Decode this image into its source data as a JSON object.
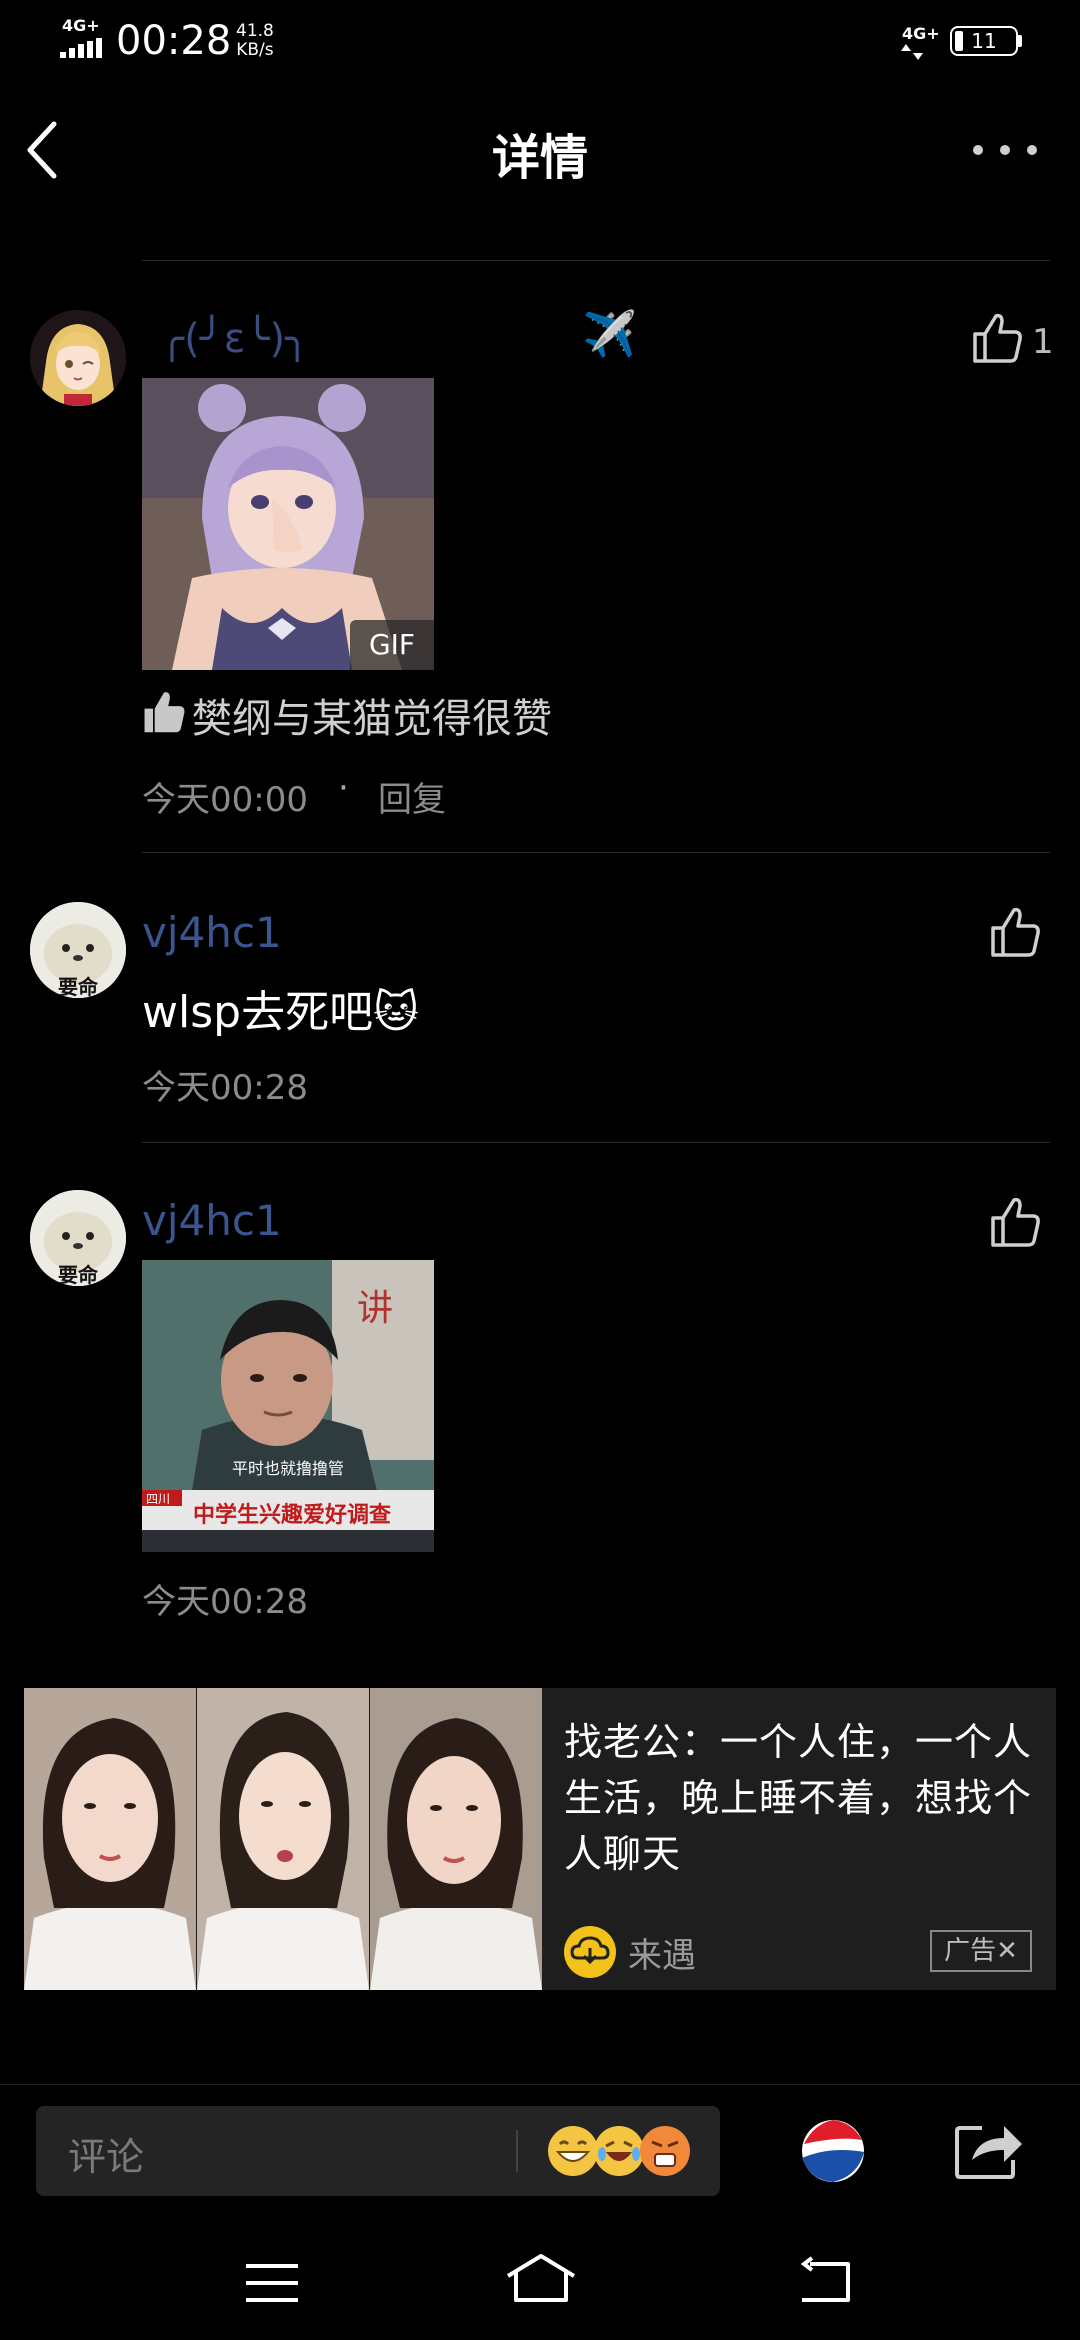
{
  "status_bar": {
    "network_left": "4G+",
    "time": "00:28",
    "speed_value": "41.8",
    "speed_unit": "KB/s",
    "network_right": "4G+",
    "battery": "11"
  },
  "header": {
    "title": "详情"
  },
  "comments": [
    {
      "username": "╭(╯ε╰)╮",
      "title_emoji": "✈️",
      "likes": "1",
      "media_badge": "GIF",
      "liked_by": "樊纲与某猫觉得很赞",
      "time": "今天00:00",
      "separator": "·",
      "reply_label": "回复"
    },
    {
      "username": "vj4hc1",
      "text": "wlsp去死吧",
      "text_emoji": "🐱",
      "time": "今天00:28"
    },
    {
      "username": "vj4hc1",
      "image_caption": "平时也就撸撸管",
      "image_banner": "中学生兴趣爱好调查",
      "image_banner_prefix": "四川",
      "time": "今天00:28"
    }
  ],
  "ad": {
    "text": "找老公：一个人住，一个人生活，晚上睡不着，想找个人聊天",
    "brand": "来遇",
    "tag": "广告",
    "tag_close": "✕"
  },
  "bottom_bar": {
    "placeholder": "评论"
  },
  "colors": {
    "background": "#000000",
    "username": "#3a5590",
    "meta": "#8c8c8c",
    "ad_bg": "#1e1e1e"
  }
}
